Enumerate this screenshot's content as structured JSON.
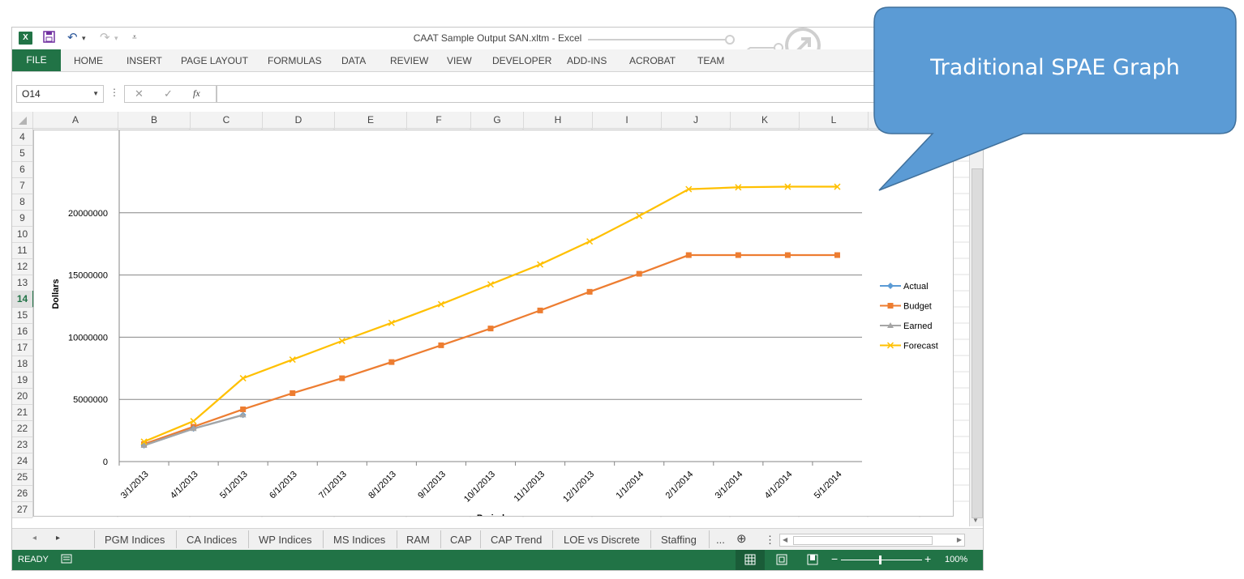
{
  "window": {
    "title": "CAAT Sample Output SAN.xltm - Excel",
    "help": "?"
  },
  "ribbon": {
    "tabs": [
      "FILE",
      "HOME",
      "INSERT",
      "PAGE LAYOUT",
      "FORMULAS",
      "DATA",
      "REVIEW",
      "VIEW",
      "DEVELOPER",
      "ADD-INS",
      "ACROBAT",
      "TEAM"
    ]
  },
  "formula_bar": {
    "name_box": "O14",
    "fx": "fx",
    "cancel": "✕",
    "enter": "✓",
    "value": ""
  },
  "grid": {
    "columns": [
      "A",
      "B",
      "C",
      "D",
      "E",
      "F",
      "G",
      "H",
      "I",
      "J",
      "K",
      "L"
    ],
    "rows": [
      "4",
      "5",
      "6",
      "7",
      "8",
      "9",
      "10",
      "11",
      "12",
      "13",
      "14",
      "15",
      "16",
      "17",
      "18",
      "19",
      "20",
      "21",
      "22",
      "23",
      "24",
      "25",
      "26",
      "27"
    ],
    "selected_row": "14"
  },
  "chart_data": {
    "type": "line",
    "title": "",
    "xlabel": "Period",
    "ylabel": "Dollars",
    "ylim": [
      0,
      25000000
    ],
    "yticks": [
      "0",
      "5000000",
      "10000000",
      "15000000",
      "20000000"
    ],
    "categories": [
      "3/1/2013",
      "4/1/2013",
      "5/1/2013",
      "6/1/2013",
      "7/1/2013",
      "8/1/2013",
      "9/1/2013",
      "10/1/2013",
      "11/1/2013",
      "12/1/2013",
      "1/1/2014",
      "2/1/2014",
      "3/1/2014",
      "4/1/2014",
      "5/1/2014"
    ],
    "legend_position": "right",
    "series": [
      {
        "name": "Actual",
        "color": "#5b9bd5",
        "marker": "diamond",
        "values": [
          1300000,
          2650000,
          3750000,
          null,
          null,
          null,
          null,
          null,
          null,
          null,
          null,
          null,
          null,
          null,
          null
        ]
      },
      {
        "name": "Budget",
        "color": "#ed7d31",
        "marker": "square",
        "values": [
          1400000,
          2800000,
          4200000,
          5500000,
          6700000,
          8000000,
          9350000,
          10700000,
          12150000,
          13650000,
          15100000,
          16600000,
          16600000,
          16600000,
          16600000
        ]
      },
      {
        "name": "Earned",
        "color": "#a5a5a5",
        "marker": "triangle",
        "values": [
          1300000,
          2650000,
          3750000,
          null,
          null,
          null,
          null,
          null,
          null,
          null,
          null,
          null,
          null,
          null,
          null
        ]
      },
      {
        "name": "Forecast",
        "color": "#ffc000",
        "marker": "x",
        "values": [
          1600000,
          3250000,
          6700000,
          8200000,
          9700000,
          11150000,
          12650000,
          14250000,
          15850000,
          17700000,
          19750000,
          21900000,
          22050000,
          22100000,
          22100000
        ]
      }
    ]
  },
  "sheet_tabs": {
    "tabs": [
      "PGM Indices",
      "CA Indices",
      "WP Indices",
      "MS Indices",
      "RAM",
      "CAP",
      "CAP Trend",
      "LOE vs Discrete",
      "Staffing"
    ],
    "more": "...",
    "add": "⊕"
  },
  "status_bar": {
    "status": "READY",
    "zoom": "100%"
  },
  "callout": {
    "text": "Traditional SPAE Graph",
    "color": "#5b9bd5"
  }
}
